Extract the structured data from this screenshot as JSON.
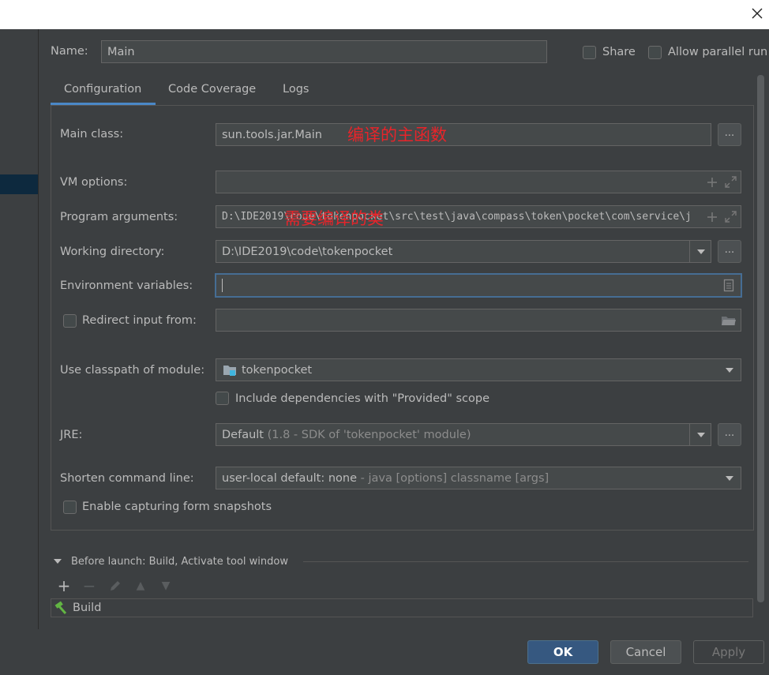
{
  "window": {
    "close_glyph": "✕"
  },
  "header": {
    "name_label": "Name:",
    "name_value": "Main",
    "share_label": "Share",
    "allow_parallel_label": "Allow parallel run"
  },
  "tabs": [
    {
      "label": "Configuration",
      "active": true
    },
    {
      "label": "Code Coverage",
      "active": false
    },
    {
      "label": "Logs",
      "active": false
    }
  ],
  "form": {
    "main_class_label": "Main class:",
    "main_class_value": "sun.tools.jar.Main",
    "main_class_annotation": "编译的主函数",
    "vm_options_label": "VM options:",
    "vm_options_value": "",
    "program_args_label": "Program arguments:",
    "program_args_value": "D:\\IDE2019\\code\\tokenpocket\\src\\test\\java\\compass\\token\\pocket\\com\\service\\j",
    "program_args_annotation": "需要编译的类",
    "working_dir_label": "Working directory:",
    "working_dir_value": "D:\\IDE2019\\code\\tokenpocket",
    "env_vars_label": "Environment variables:",
    "env_vars_value": "",
    "redirect_label": "Redirect input from:",
    "redirect_value": "",
    "classpath_label": "Use classpath of module:",
    "classpath_value": "tokenpocket",
    "include_deps_label": "Include dependencies with \"Provided\" scope",
    "jre_label": "JRE:",
    "jre_value_main": "Default",
    "jre_value_hint": "(1.8 - SDK of 'tokenpocket' module)",
    "shorten_label": "Shorten command line:",
    "shorten_value_main": "user-local default: none",
    "shorten_value_hint": "- java [options] classname [args]",
    "snapshots_label": "Enable capturing form snapshots",
    "dots": "..."
  },
  "before_launch": {
    "title": "Before launch: Build, Activate tool window",
    "items": [
      {
        "label": "Build"
      }
    ]
  },
  "buttons": {
    "ok": "OK",
    "cancel": "Cancel",
    "apply": "Apply"
  },
  "colors": {
    "accent": "#4a88c7",
    "ok_bg": "#365880",
    "annotation": "#e8242a"
  }
}
